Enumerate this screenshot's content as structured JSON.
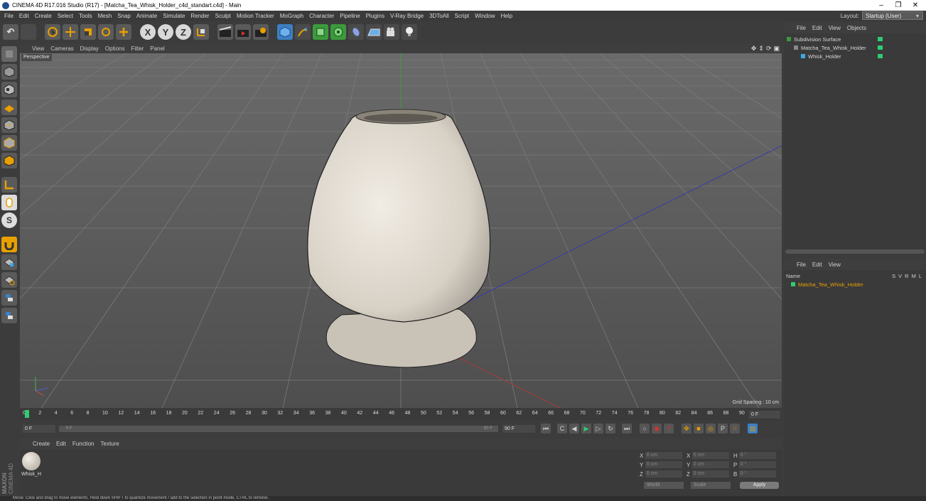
{
  "window": {
    "title": "CINEMA 4D R17.016 Studio (R17) - [Matcha_Tea_Whisk_Holder_c4d_standart.c4d] - Main",
    "minimize": "–",
    "restore": "❐",
    "close": "✕"
  },
  "menubar": [
    "File",
    "Edit",
    "Create",
    "Select",
    "Tools",
    "Mesh",
    "Snap",
    "Animate",
    "Simulate",
    "Render",
    "Sculpt",
    "Motion Tracker",
    "MoGraph",
    "Character",
    "Pipeline",
    "Plugins",
    "V-Ray Bridge",
    "3DToAll",
    "Script",
    "Window",
    "Help"
  ],
  "layout": {
    "label": "Layout:",
    "value": "Startup (User)"
  },
  "toolbar": {
    "undo": "↶",
    "x": "X",
    "y": "Y",
    "z": "Z"
  },
  "viewport": {
    "menu": [
      "View",
      "Cameras",
      "Display",
      "Options",
      "Filter",
      "Panel"
    ],
    "camera": "Perspective",
    "grid_spacing": "Grid Spacing : 10 cm"
  },
  "timeline": {
    "ticks": [
      "0",
      "2",
      "4",
      "6",
      "8",
      "10",
      "12",
      "14",
      "16",
      "18",
      "20",
      "22",
      "24",
      "26",
      "28",
      "30",
      "32",
      "34",
      "36",
      "38",
      "40",
      "42",
      "44",
      "46",
      "48",
      "50",
      "52",
      "54",
      "56",
      "58",
      "60",
      "62",
      "64",
      "66",
      "68",
      "70",
      "72",
      "74",
      "76",
      "78",
      "80",
      "82",
      "84",
      "86",
      "88",
      "90"
    ],
    "current_frame": "0 F"
  },
  "frames": {
    "start": "0 F",
    "slider_start": "0 F",
    "slider_end": "90 F",
    "end": "90 F"
  },
  "material_manager": {
    "menu": [
      "Create",
      "Edit",
      "Function",
      "Texture"
    ],
    "materials": [
      {
        "name": "Whisk_H"
      }
    ]
  },
  "coordinates": {
    "rows": [
      {
        "a": "X",
        "av": "0 cm",
        "b": "X",
        "bv": "0 cm",
        "c": "H",
        "cv": "0 °"
      },
      {
        "a": "Y",
        "av": "0 cm",
        "b": "Y",
        "bv": "0 cm",
        "c": "P",
        "cv": "0 °"
      },
      {
        "a": "Z",
        "av": "0 cm",
        "b": "Z",
        "bv": "0 cm",
        "c": "B",
        "cv": "0 °"
      }
    ],
    "world": "World",
    "scale": "Scale",
    "apply": "Apply"
  },
  "object_manager": {
    "menu": [
      "File",
      "Edit",
      "View",
      "Objects"
    ],
    "objects": [
      {
        "name": "Subdivision Surface",
        "indent": 0
      },
      {
        "name": "Matcha_Tea_Whisk_Holder",
        "indent": 1
      },
      {
        "name": "Whisk_Holder",
        "indent": 2
      }
    ]
  },
  "attr_manager": {
    "menu": [
      "File",
      "Edit",
      "View"
    ],
    "col_name": "Name",
    "cols": [
      "S",
      "V",
      "R",
      "M",
      "L"
    ],
    "layer": "Matcha_Tea_Whisk_Holder"
  },
  "status": "Move: Click and drag to move elements. Hold down SHIFT to quantize movement / add to the selection in point mode, CTRL to remove.",
  "brand": {
    "line1": "MAXON",
    "line2": "CINEMA 4D"
  },
  "colors": {
    "accent": "#e8a000",
    "green": "#2ecc71",
    "object_name_orange": "#e8a000"
  }
}
